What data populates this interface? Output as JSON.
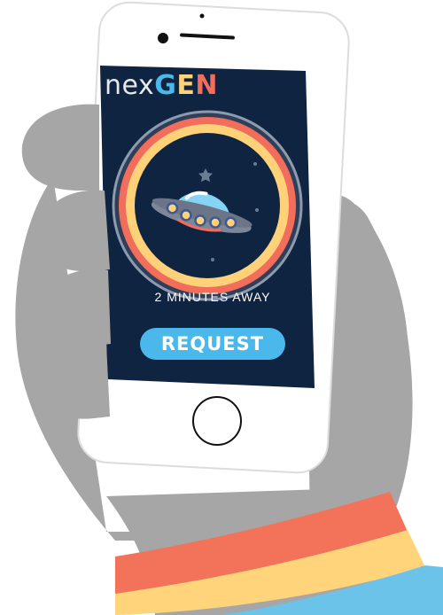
{
  "app": {
    "brand_light": "nex",
    "brand_g": "G",
    "brand_e": "E",
    "brand_n": "N"
  },
  "main": {
    "eta_text": "2 MINUTES AWAY",
    "request_label": "REQUEST"
  },
  "icons": {
    "hero": "ufo-icon",
    "decor": "star-icon",
    "home": "home-button-icon",
    "camera": "front-camera-icon"
  },
  "colors": {
    "screen_bg": "#0f2440",
    "accent_blue": "#4ab8ea",
    "accent_yellow": "#ffd27a",
    "accent_coral": "#f26d5b",
    "hand": "#a6a6a6",
    "sleeve_orange": "#f2735a",
    "sleeve_yellow": "#ffd47a",
    "sleeve_blue": "#6cc3ea"
  }
}
